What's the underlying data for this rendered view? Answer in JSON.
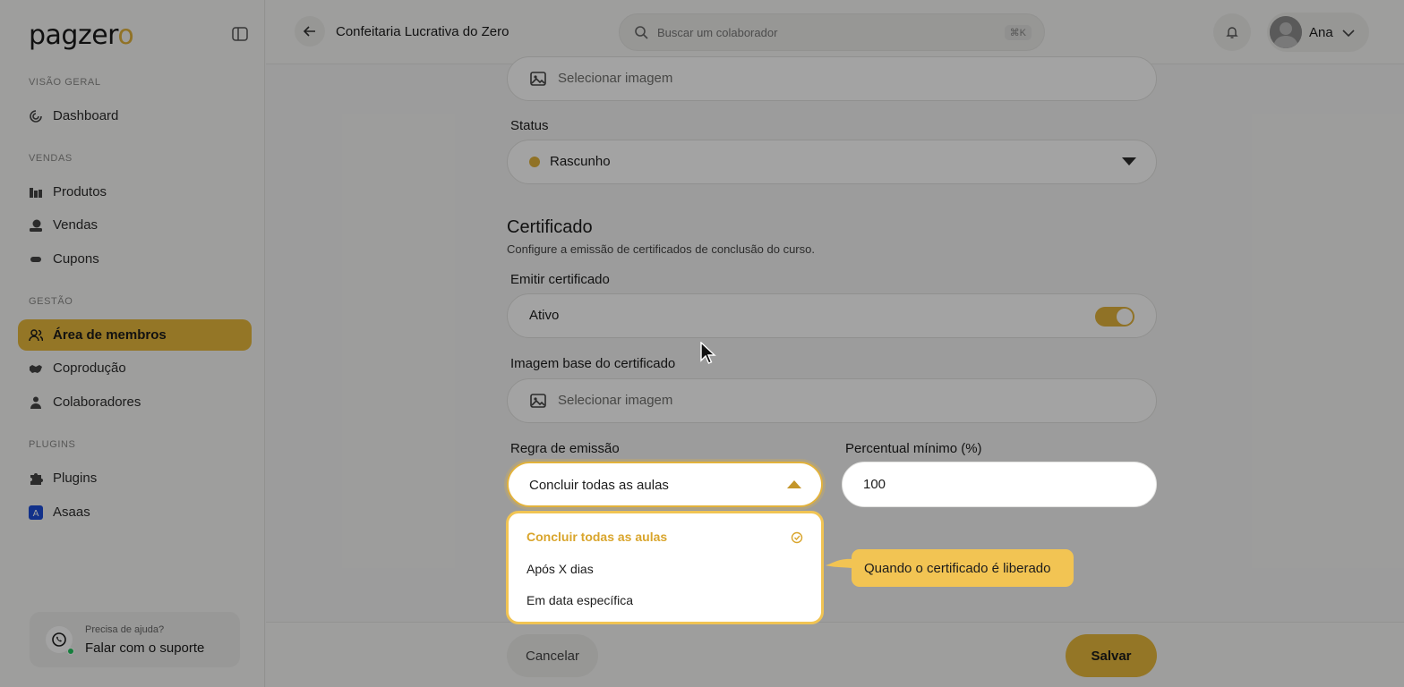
{
  "sidebar": {
    "logo_main": "pagzer",
    "logo_end": "o",
    "sections": {
      "overview": "VISÃO GERAL",
      "sales": "VENDAS",
      "management": "GESTÃO",
      "plugins": "PLUGINS"
    },
    "items": {
      "dashboard": "Dashboard",
      "products": "Produtos",
      "sales": "Vendas",
      "coupons": "Cupons",
      "members": "Área de membros",
      "coproduction": "Coprodução",
      "collaborators": "Colaboradores",
      "plugins": "Plugins",
      "asaas": "Asaas"
    },
    "support": {
      "question": "Precisa de ajuda?",
      "action": "Falar com o suporte"
    }
  },
  "header": {
    "course_title": "Confeitaria Lucrativa do Zero",
    "search_placeholder": "Buscar um colaborador",
    "search_shortcut": "⌘K",
    "user_name": "Ana"
  },
  "form": {
    "top_image_placeholder": "Selecionar imagem",
    "status_label": "Status",
    "status_value": "Rascunho",
    "certificate_title": "Certificado",
    "certificate_desc": "Configure a emissão de certificados de conclusão do curso.",
    "emit_label": "Emitir certificado",
    "emit_value": "Ativo",
    "emit_enabled": true,
    "base_image_label": "Imagem base do certificado",
    "base_image_placeholder": "Selecionar imagem",
    "rule_label": "Regra de emissão",
    "rule_value": "Concluir todas as aulas",
    "pct_label": "Percentual mínimo (%)",
    "pct_value": "100"
  },
  "dropdown": {
    "options": [
      "Concluir todas as aulas",
      "Após X dias",
      "Em data específica"
    ],
    "selected_index": 0
  },
  "tooltip": "Quando o certificado é liberado",
  "footer": {
    "cancel": "Cancelar",
    "save": "Salvar"
  },
  "colors": {
    "accent": "#e8b93c",
    "accent_light": "#f2c453",
    "selected_text": "#d9a52c"
  }
}
